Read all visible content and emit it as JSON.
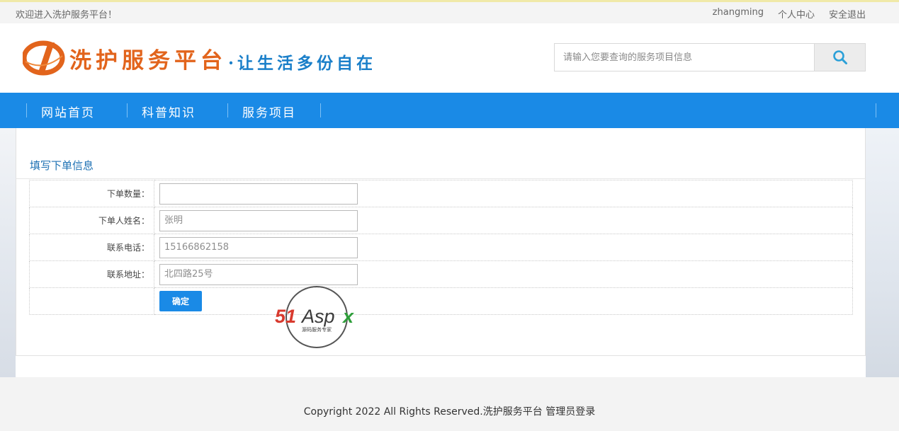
{
  "topbar": {
    "welcome": "欢迎进入洗护服务平台！",
    "username": "zhangming",
    "user_center": "个人中心",
    "logout": "安全退出"
  },
  "header": {
    "logo_title": "洗护服务平台",
    "logo_slogan": "·让生活多份自在",
    "logo_color": "#e2641c",
    "slogan_color": "#1a7fc9"
  },
  "search": {
    "placeholder": "请输入您要查询的服务项目信息",
    "value": "",
    "icon": "search-icon"
  },
  "nav": {
    "background": "#1a8ae6",
    "items": [
      {
        "label": "网站首页"
      },
      {
        "label": "科普知识"
      },
      {
        "label": "服务项目"
      }
    ]
  },
  "form": {
    "title": "填写下单信息",
    "fields": [
      {
        "label": "下单数量：",
        "value": "",
        "placeholder": ""
      },
      {
        "label": "下单人姓名：",
        "value": "",
        "placeholder": "张明"
      },
      {
        "label": "联系电话：",
        "value": "",
        "placeholder": "15166862158"
      },
      {
        "label": "联系地址：",
        "value": "",
        "placeholder": "北四路25号"
      }
    ],
    "submit_label": "确定"
  },
  "watermark": {
    "brand": "51Aspx",
    "tagline": "源码服务专家"
  },
  "footer": {
    "text": "Copyright 2022 All Rights Reserved.洗护服务平台 管理员登录"
  }
}
